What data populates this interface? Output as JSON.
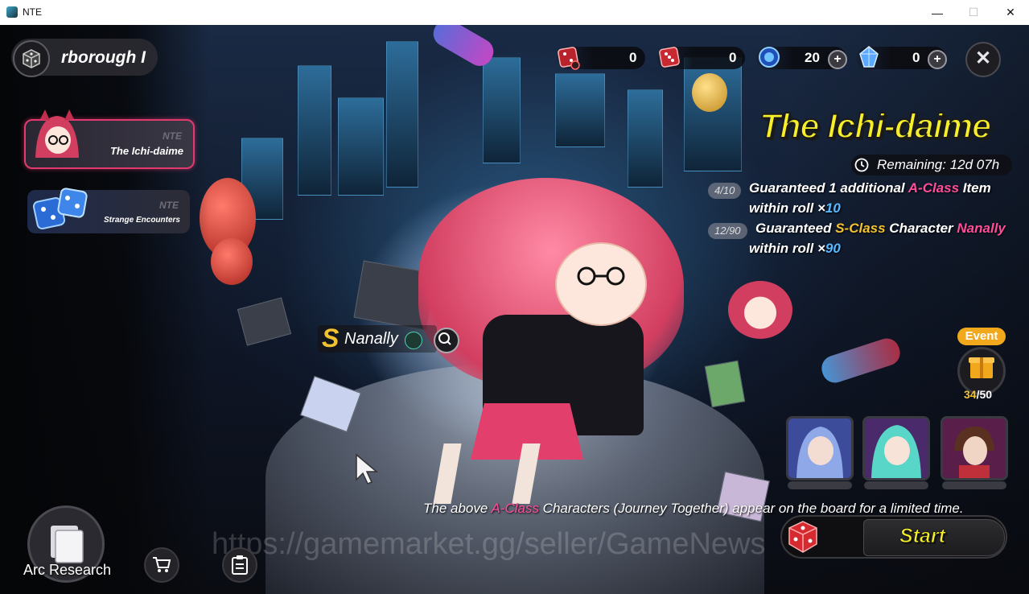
{
  "window": {
    "title": "NTE",
    "minimize": "—",
    "maximize": "☐",
    "close": "✕"
  },
  "location": {
    "text": "rborough I"
  },
  "banners": [
    {
      "brand": "NTE",
      "label": "The Ichi-daime"
    },
    {
      "brand": "NTE",
      "label": "Strange Encounters"
    }
  ],
  "currencies": [
    {
      "icon": "red-dice-ticket-icon",
      "value": "0"
    },
    {
      "icon": "red-dice-icon",
      "value": "0"
    },
    {
      "icon": "blue-orb-icon",
      "value": "20",
      "plus": "+"
    },
    {
      "icon": "crystal-icon",
      "value": "0",
      "plus": "+"
    }
  ],
  "close_label": "✕",
  "banner_info": {
    "title": "The Ichi-daime",
    "remaining": "Remaining: 12d 07h",
    "guarantee_a": {
      "badge": "4/10",
      "prefix": "Guaranteed 1 additional ",
      "class": "A-Class",
      "suffix": " Item",
      "line2": "within roll ×",
      "roll": "10"
    },
    "guarantee_s": {
      "badge": "12/90",
      "prefix": "Guaranteed ",
      "class": "S-Class",
      "middle": " Character ",
      "name": "Nanally",
      "line2": "within roll ×",
      "roll": "90"
    }
  },
  "featured": {
    "rank": "S",
    "name": "Nanally"
  },
  "event": {
    "label": "Event",
    "current": "34",
    "total": "/50"
  },
  "notice": {
    "prefix": "The above ",
    "class": "A-Class",
    "suffix": " Characters (Journey Together) appear on the board for a limited time."
  },
  "start_label": "Start",
  "arc_research": "Arc Research",
  "watermark": "https://gamemarket.gg/seller/GameNews",
  "colors": {
    "accent_pink": "#e23a6f",
    "title_yellow": "#f7ef2c",
    "a_class_pink": "#ff4d9a",
    "roll_blue": "#57b8ff",
    "s_class_gold": "#f2c230",
    "event_orange": "#f2a81c"
  }
}
